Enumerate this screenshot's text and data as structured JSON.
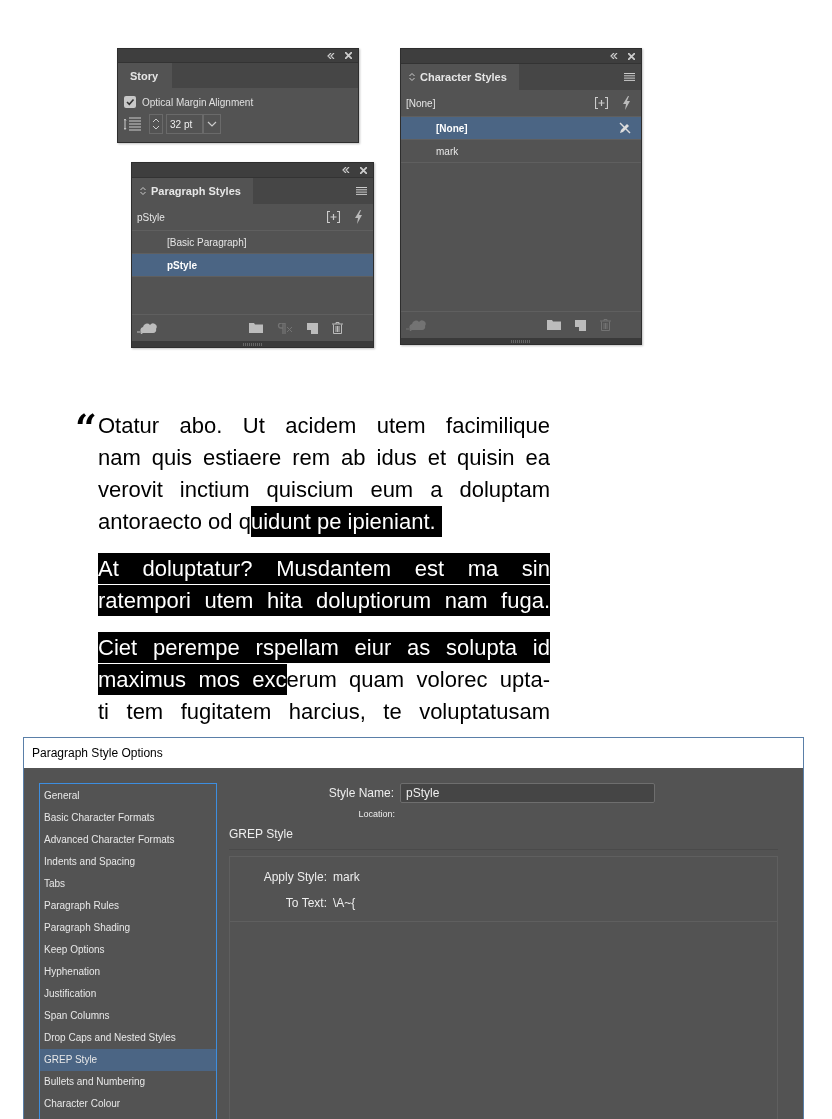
{
  "story_panel": {
    "tab": "Story",
    "optical_margin": {
      "label": "Optical Margin Alignment",
      "checked": true
    },
    "size": "32 pt"
  },
  "paragraph_styles_panel": {
    "tab": "Paragraph Styles",
    "current": "pStyle",
    "items": [
      {
        "label": "[Basic Paragraph]",
        "selected": false
      },
      {
        "label": "pStyle",
        "selected": true
      }
    ],
    "footer": [
      {
        "kind": "cloud",
        "disabled": false
      },
      {
        "kind": "folder",
        "disabled": false
      },
      {
        "kind": "clear",
        "disabled": true
      },
      {
        "kind": "new",
        "disabled": false
      },
      {
        "kind": "trash",
        "disabled": false
      }
    ]
  },
  "character_styles_panel": {
    "tab": "Character Styles",
    "current": "[None]",
    "items": [
      {
        "label": "[None]",
        "selected": true,
        "locked": true
      },
      {
        "label": "mark",
        "selected": false,
        "locked": false
      }
    ],
    "footer": [
      {
        "kind": "cloud",
        "disabled": true
      },
      {
        "kind": "folder",
        "disabled": false
      },
      {
        "kind": "new",
        "disabled": false
      },
      {
        "kind": "trash",
        "disabled": true
      }
    ]
  },
  "text_frame": {
    "quote_mark": "“",
    "paragraphs": [
      {
        "lines": [
          {
            "justified": true,
            "segments": [
              {
                "text": "Otatur abo. Ut acidem utem facimilique",
                "marked": false
              }
            ]
          },
          {
            "justified": true,
            "segments": [
              {
                "text": "nam quis estiaere rem ab idus et quisin ea",
                "marked": false
              }
            ]
          },
          {
            "justified": true,
            "segments": [
              {
                "text": "verovit inctium quiscium eum a doluptam",
                "marked": false
              }
            ]
          },
          {
            "justified": false,
            "segments": [
              {
                "text": "antoraecto od q",
                "marked": false
              },
              {
                "text": "uidunt pe ipieniant. ",
                "marked": true
              }
            ]
          }
        ]
      },
      {
        "lines": [
          {
            "justified": true,
            "segments": [
              {
                "text": "At doluptatur? Musdantem est ma sin",
                "marked": true
              }
            ]
          },
          {
            "justified": true,
            "segments": [
              {
                "text": "ratempori utem hita doluptiorum nam fuga.",
                "marked": true
              }
            ]
          }
        ]
      },
      {
        "lines": [
          {
            "justified": true,
            "segments": [
              {
                "text": "Ciet perempe rspellam eiur as solupta id",
                "marked": true
              }
            ]
          },
          {
            "justified": true,
            "segments": [
              {
                "text": "maximus mos exc",
                "marked": true
              },
              {
                "text": "erum quam volorec upta-",
                "marked": false
              }
            ]
          },
          {
            "justified": true,
            "segments": [
              {
                "text": "ti tem fugitatem harcius, te voluptatusam",
                "marked": false
              }
            ]
          }
        ]
      }
    ]
  },
  "dialog": {
    "title": "Paragraph Style Options",
    "categories": [
      {
        "label": "General",
        "selected": false
      },
      {
        "label": "Basic Character Formats",
        "selected": false
      },
      {
        "label": "Advanced Character Formats",
        "selected": false
      },
      {
        "label": "Indents and Spacing",
        "selected": false
      },
      {
        "label": "Tabs",
        "selected": false
      },
      {
        "label": "Paragraph Rules",
        "selected": false
      },
      {
        "label": "Paragraph Shading",
        "selected": false
      },
      {
        "label": "Keep Options",
        "selected": false
      },
      {
        "label": "Hyphenation",
        "selected": false
      },
      {
        "label": "Justification",
        "selected": false
      },
      {
        "label": "Span Columns",
        "selected": false
      },
      {
        "label": "Drop Caps and Nested Styles",
        "selected": false
      },
      {
        "label": "GREP Style",
        "selected": true
      },
      {
        "label": "Bullets and Numbering",
        "selected": false
      },
      {
        "label": "Character Colour",
        "selected": false
      }
    ],
    "style_name_label": "Style Name:",
    "style_name": "pStyle",
    "location_label": "Location:",
    "section": "GREP Style",
    "rules": [
      {
        "label": "Apply Style:",
        "value": "mark"
      },
      {
        "label": "To Text:",
        "value": "\\A~{"
      }
    ]
  }
}
